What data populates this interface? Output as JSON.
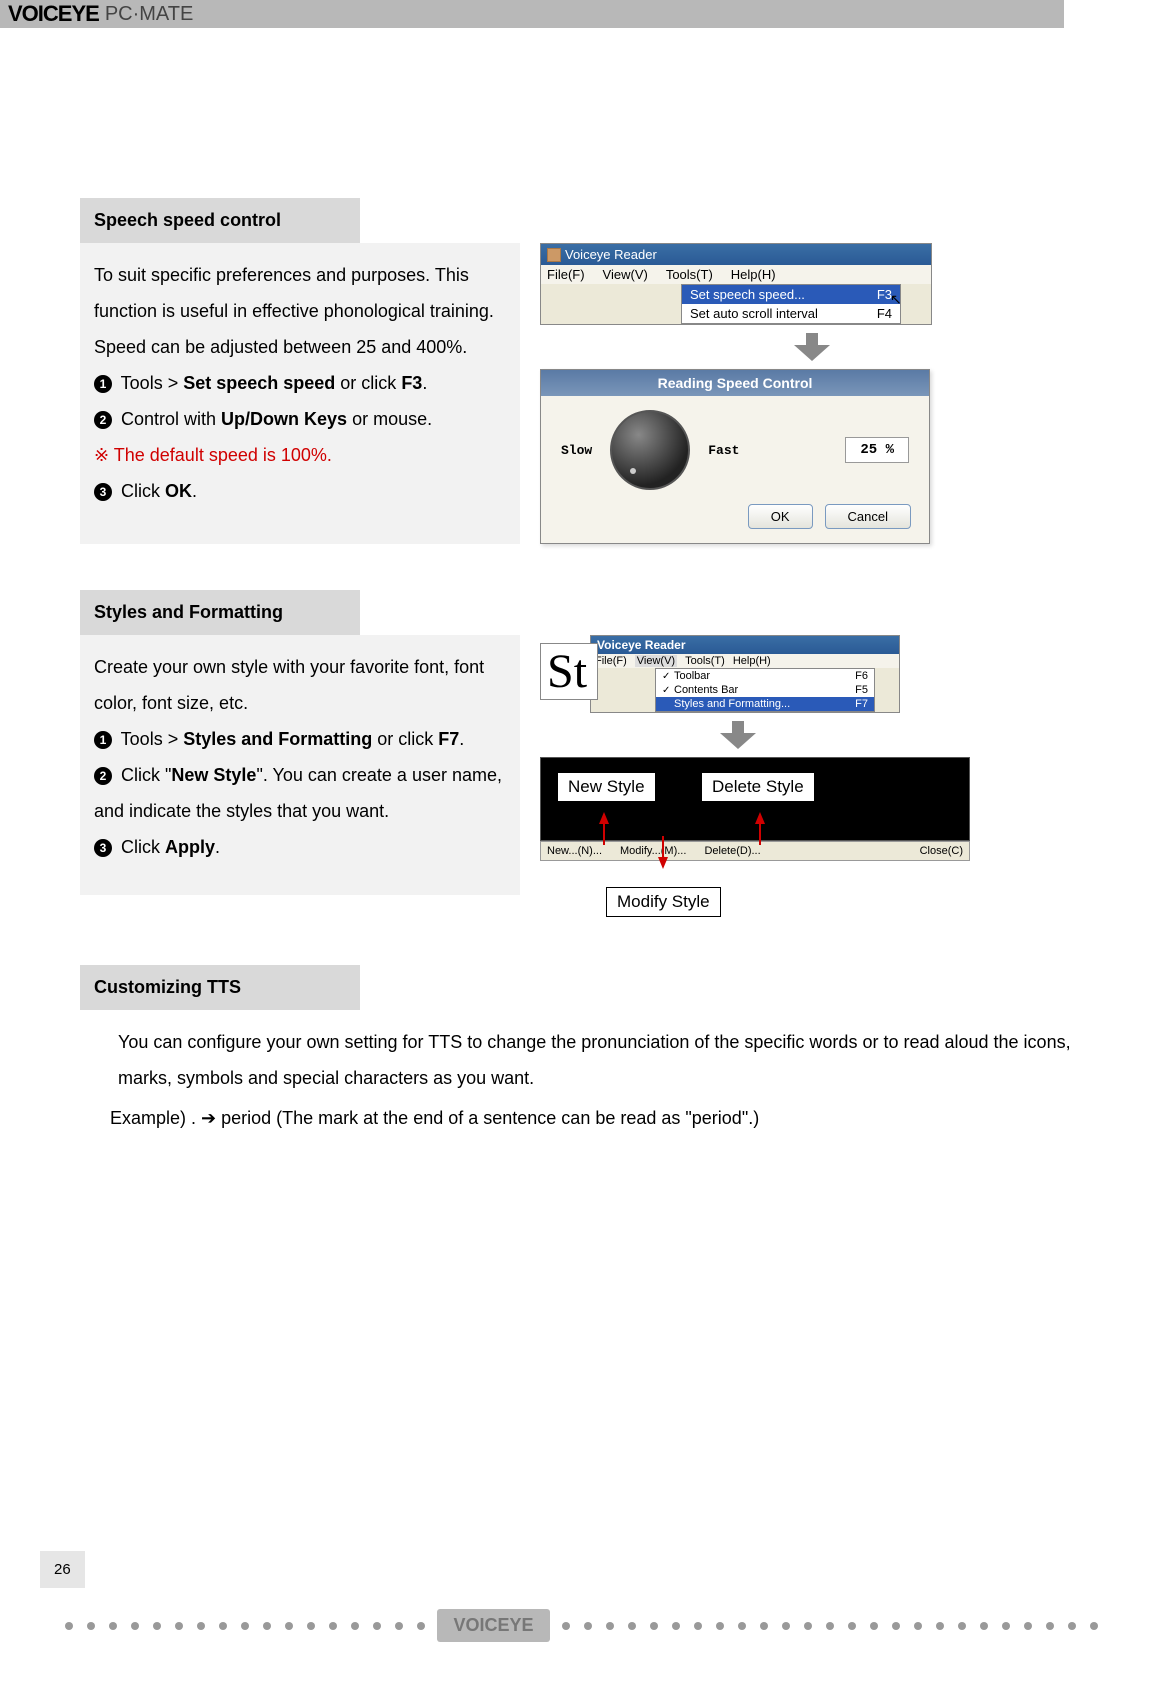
{
  "header": {
    "logo_main": "VOICEYE",
    "logo_sub": "PC·MATE"
  },
  "section1": {
    "title": "Speech speed control",
    "p1": "To suit specific preferences and purposes. This function is useful in effective phonological training. Speed can be adjusted between 25 and 400%.",
    "step1_pre": " Tools > ",
    "step1_b": "Set speech speed",
    "step1_mid": " or click ",
    "step1_b2": "F3",
    "step1_end": ".",
    "step2_pre": " Control with ",
    "step2_b": "Up/Down Keys",
    "step2_end": " or mouse.",
    "note": "※ The default speed is 100%.",
    "step3_pre": " Click ",
    "step3_b": "OK",
    "step3_end": "."
  },
  "ss1": {
    "win_title": "Voiceye Reader",
    "menu_file": "File(F)",
    "menu_view": "View(V)",
    "menu_tools": "Tools(T)",
    "menu_help": "Help(H)",
    "dd1": "Set speech speed...",
    "dd1_sc": "F3",
    "dd2": "Set auto scroll interval",
    "dd2_sc": "F4",
    "dialog_title": "Reading Speed Control",
    "slow": "Slow",
    "fast": "Fast",
    "pct": "25 %",
    "ok": "OK",
    "cancel": "Cancel"
  },
  "section2": {
    "title": "Styles and Formatting",
    "p1": "Create your own style with your favorite font, font color, font size, etc.",
    "step1_pre": " Tools > ",
    "step1_b": "Styles and Formatting",
    "step1_mid": " or click ",
    "step1_b2": "F7",
    "step1_end": ".",
    "step2_pre": " Click \"",
    "step2_b": "New Style",
    "step2_end": "\". You can create a user name, and indicate the styles that you want.",
    "step3_pre": " Click ",
    "step3_b": "Apply",
    "step3_end": "."
  },
  "ss2": {
    "win_title": "Voiceye Reader",
    "menu_file": "File(F)",
    "menu_view": "View(V)",
    "menu_tools": "Tools(T)",
    "menu_help": "Help(H)",
    "dd1": "Toolbar",
    "dd1_sc": "F6",
    "dd2": "Contents Bar",
    "dd2_sc": "F5",
    "dd3": "Styles and Formatting...",
    "dd3_sc": "F7",
    "big_st": "St",
    "btn_new": "New...(N)...",
    "btn_modify": "Modify...(M)...",
    "btn_delete": "Delete(D)...",
    "btn_close": "Close(C)",
    "label_new": "New Style",
    "label_delete": "Delete Style",
    "label_modify": "Modify Style"
  },
  "section3": {
    "title": "Customizing TTS",
    "p1": "You can configure your own setting for TTS to change the pronunciation of the specific words or to read aloud the icons, marks, symbols and special characters as you want.",
    "p2": "Example) . ➔ period (The mark at the end of a sentence can be read as \"period\".)"
  },
  "page_number": "26",
  "footer_logo": "VOICEYE"
}
